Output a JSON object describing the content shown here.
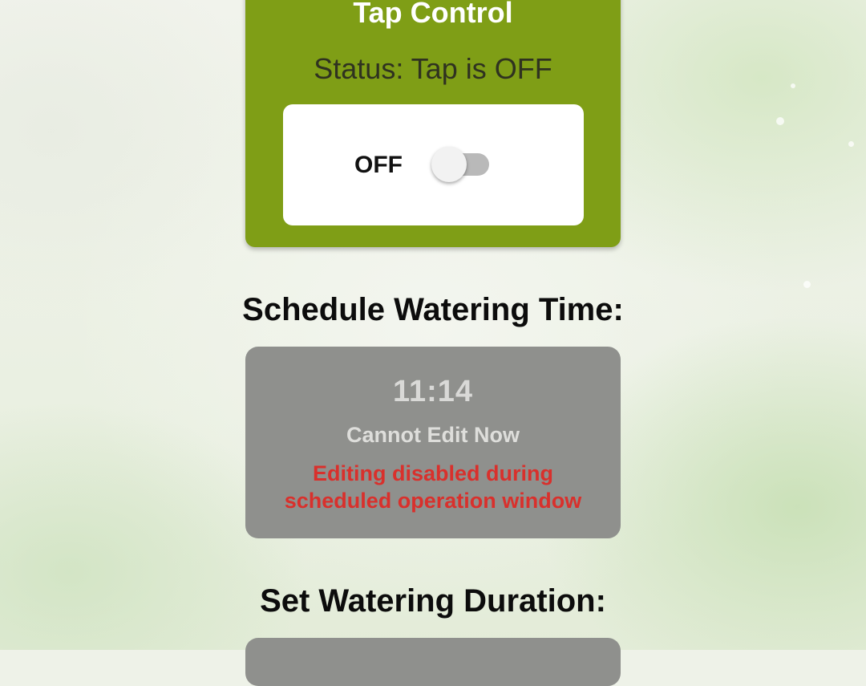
{
  "tap_control": {
    "title": "Tap Control",
    "status_text": "Status: Tap is OFF",
    "switch_label": "OFF",
    "switch_on": false
  },
  "schedule": {
    "heading": "Schedule Watering Time:",
    "time": "11:14",
    "subtitle": "Cannot Edit Now",
    "warning_line1": "Editing disabled during",
    "warning_line2": "scheduled operation window"
  },
  "duration": {
    "heading": "Set Watering Duration:"
  },
  "colors": {
    "card_green": "#7f9e16",
    "disabled_gray": "#8f908d",
    "warning_red": "#d9302c",
    "switch_track_off": "#b9b9b9"
  }
}
